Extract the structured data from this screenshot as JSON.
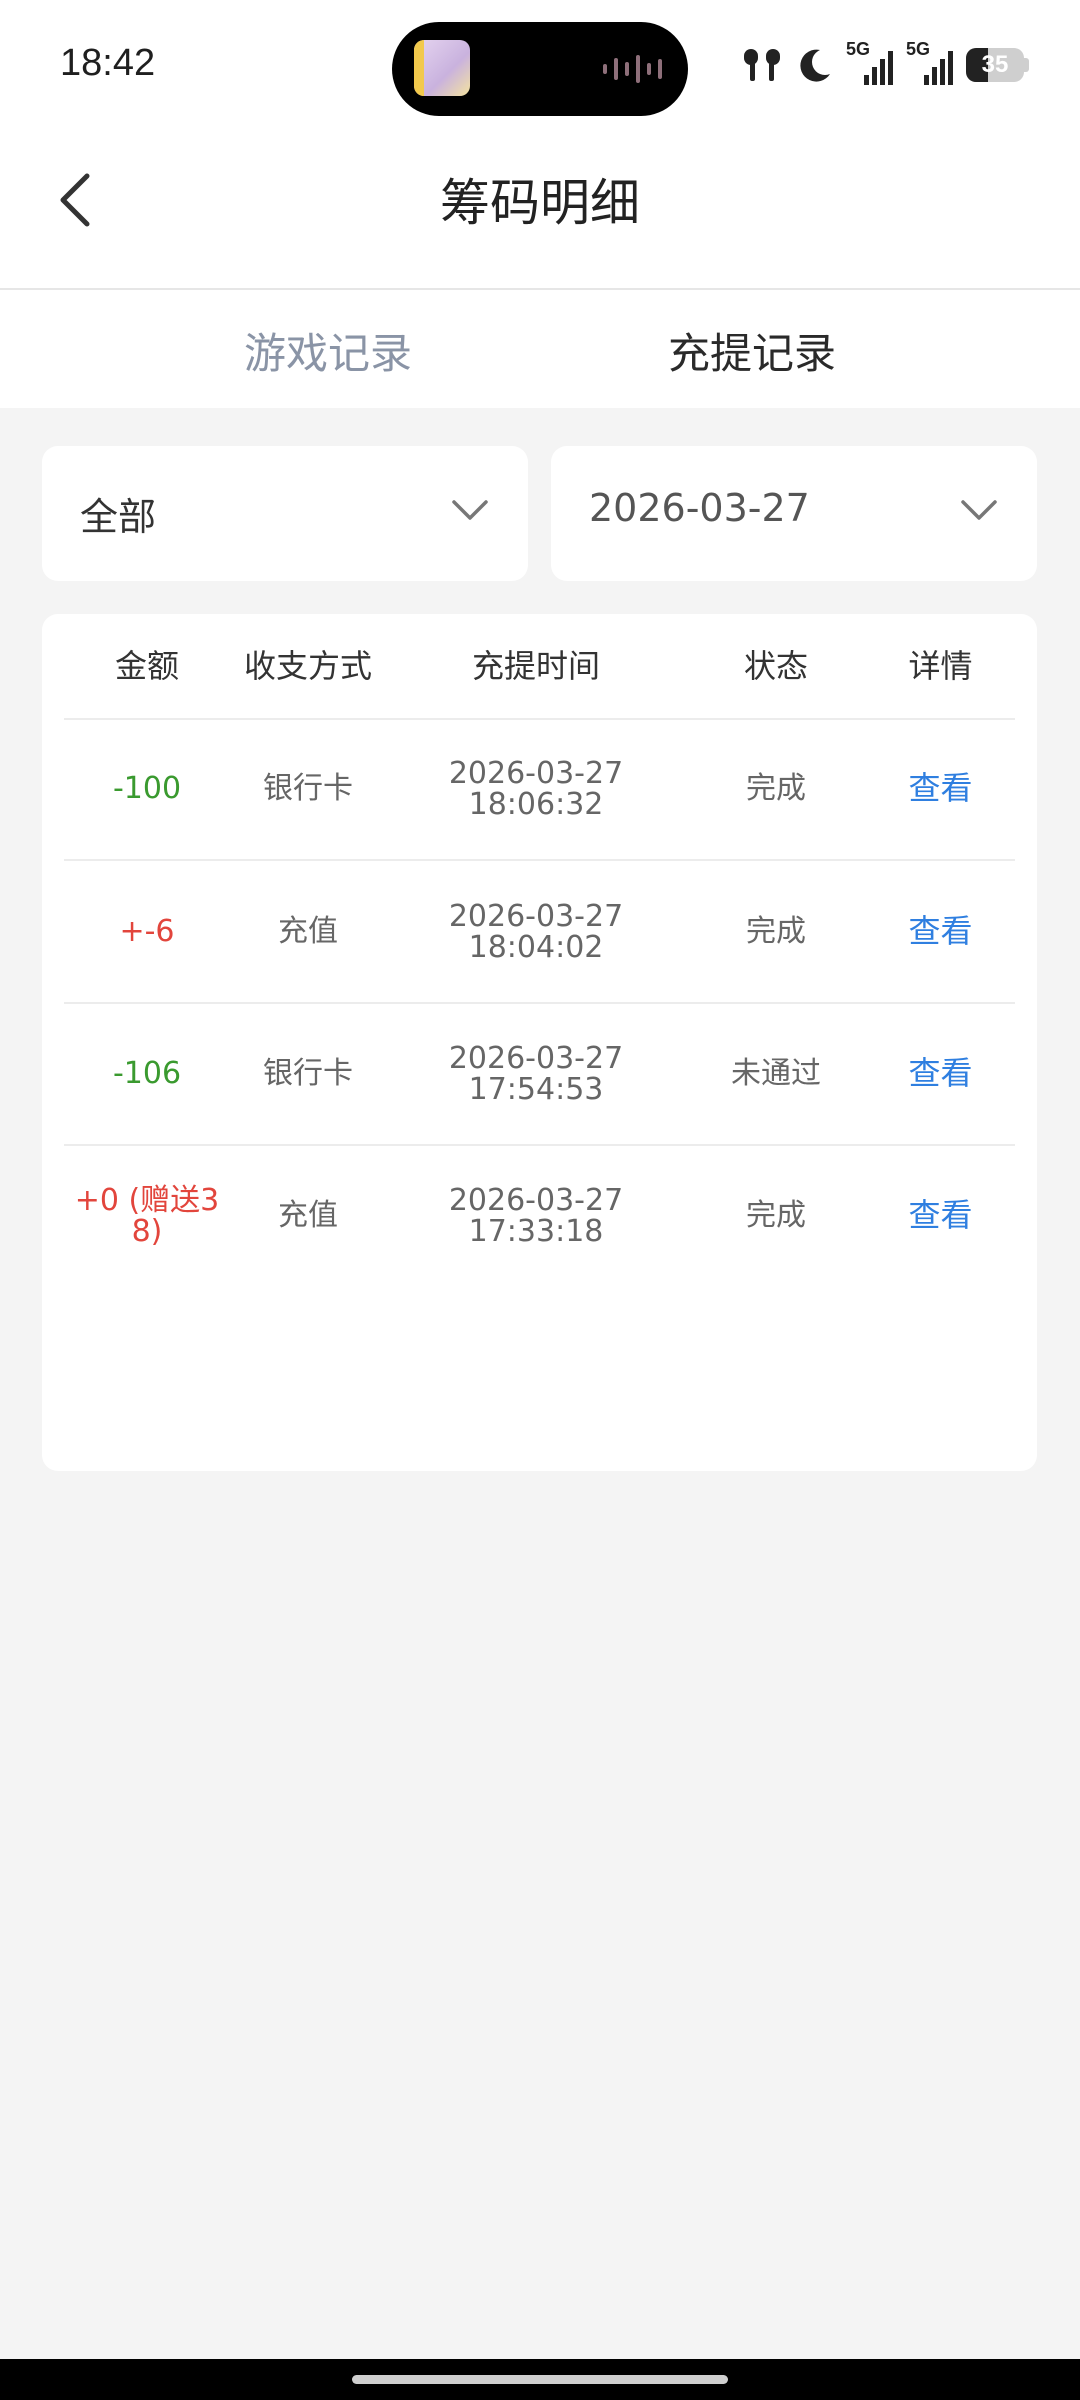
{
  "status_bar": {
    "time": "18:42",
    "network_1": "5G",
    "network_2": "5G",
    "battery": "35"
  },
  "header": {
    "title": "筹码明细"
  },
  "tabs": [
    {
      "label": "游戏记录",
      "active": false
    },
    {
      "label": "充提记录",
      "active": true
    }
  ],
  "filters": {
    "type": "全部",
    "date": "2026-03-27"
  },
  "table": {
    "columns": [
      "金额",
      "收支方式",
      "充提时间",
      "状态",
      "详情"
    ],
    "rows": [
      {
        "amount": "-100",
        "amount_color": "#3a9a2f",
        "method": "银行卡",
        "date": "2026-03-27",
        "time": "18:06:32",
        "status": "完成",
        "detail": "查看"
      },
      {
        "amount": "+-6",
        "amount_color": "#e2453c",
        "method": "充值",
        "date": "2026-03-27",
        "time": "18:04:02",
        "status": "完成",
        "detail": "查看"
      },
      {
        "amount": "-106",
        "amount_color": "#3a9a2f",
        "method": "银行卡",
        "date": "2026-03-27",
        "time": "17:54:53",
        "status": "未通过",
        "detail": "查看"
      },
      {
        "amount": "+0 (赠送38)",
        "amount_color": "#e2453c",
        "method": "充值",
        "date": "2026-03-27",
        "time": "17:33:18",
        "status": "完成",
        "detail": "查看"
      }
    ]
  },
  "icons": {
    "back": "chevron-left-icon",
    "dropdown": "chevron-down-icon"
  },
  "colors": {
    "negative_amount": "#3a9a2f",
    "positive_amount": "#e2453c",
    "link": "#2f7fe0",
    "inactive_tab": "#8a94a6"
  }
}
